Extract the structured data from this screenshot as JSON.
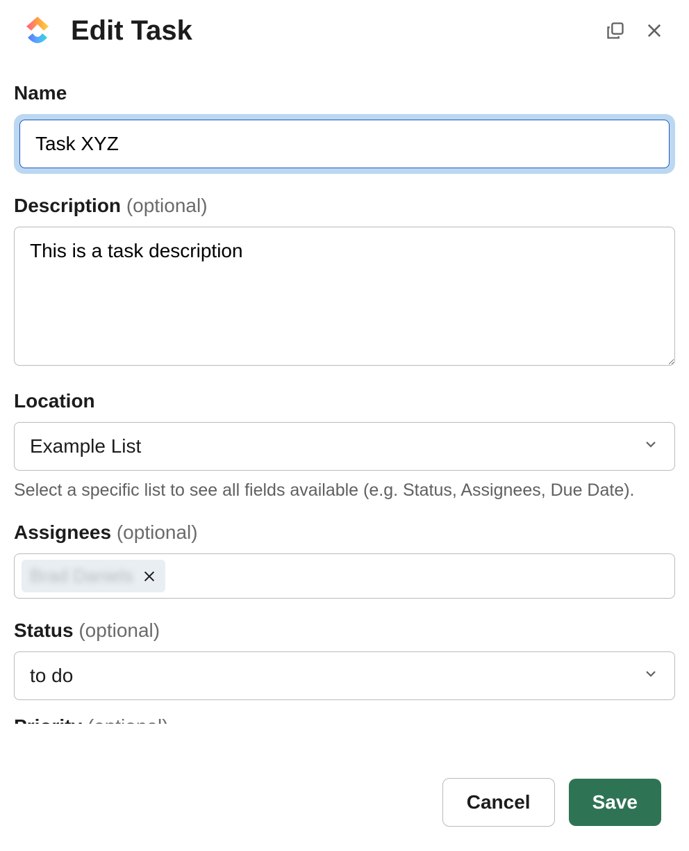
{
  "header": {
    "title": "Edit Task"
  },
  "fields": {
    "name": {
      "label": "Name",
      "value": "Task XYZ"
    },
    "description": {
      "label": "Description",
      "optional": "(optional)",
      "value": "This is a task description"
    },
    "location": {
      "label": "Location",
      "value": "Example List",
      "helper": "Select a specific list to see all fields available (e.g. Status, Assignees, Due Date)."
    },
    "assignees": {
      "label": "Assignees",
      "optional": "(optional)",
      "tags": [
        {
          "name": "Brad Daniels"
        }
      ]
    },
    "status": {
      "label": "Status",
      "optional": "(optional)",
      "value": "to do"
    },
    "priority": {
      "label": "Priority",
      "optional": "(optional)"
    }
  },
  "footer": {
    "cancel": "Cancel",
    "save": "Save"
  }
}
